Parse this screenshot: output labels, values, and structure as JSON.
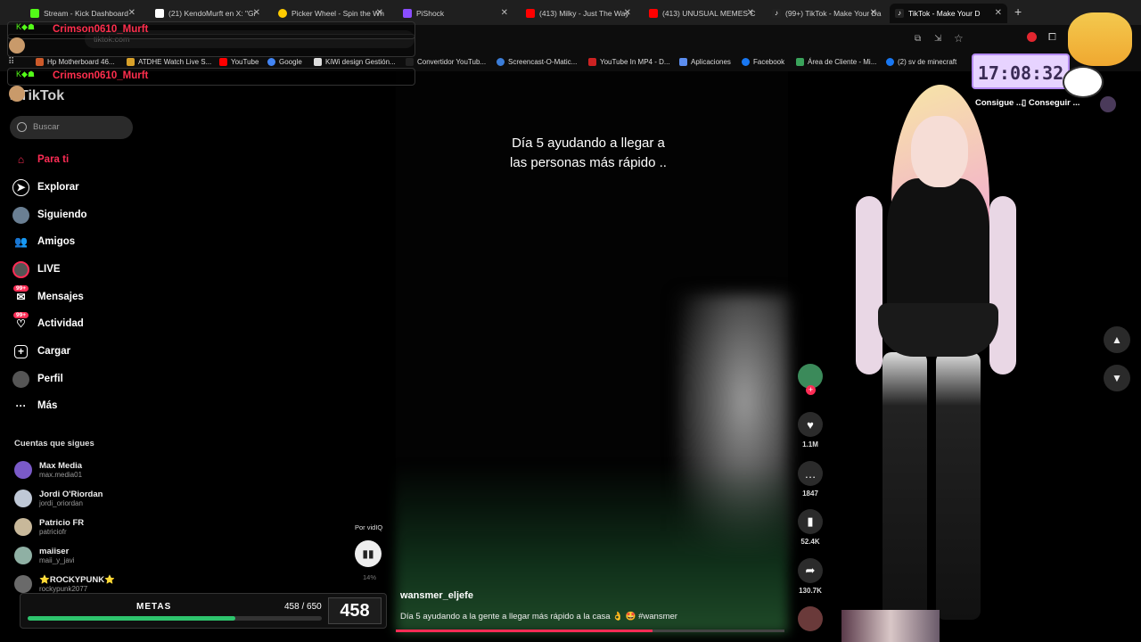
{
  "browser": {
    "tabs": [
      {
        "label": "Stream - Kick Dashboard",
        "color": "#53fc18"
      },
      {
        "label": "(21) KendoMurft en X: \"Gr",
        "color": "#ffffff"
      },
      {
        "label": "Picker Wheel - Spin the Wh",
        "color": "#ffcc00"
      },
      {
        "label": "PiShock",
        "color": "#8a4dff"
      },
      {
        "label": "(413) Milky - Just The Way",
        "color": "#ff0000"
      },
      {
        "label": "(413) UNUSUAL MEMES C",
        "color": "#ff0000"
      },
      {
        "label": "(99+) TikTok - Make Your Da",
        "color": "#ffffff"
      },
      {
        "label": "TikTok - Make Your D",
        "color": "#ffffff"
      }
    ],
    "url": "tiktok.com",
    "bookmarks": [
      "Hp Motherboard 46...",
      "ATDHE Watch Live S...",
      "YouTube",
      "Google",
      "KiWi design Gestión...",
      "Convertidor YouTub...",
      "Screencast-O-Matic...",
      "YouTube In MP4 - D...",
      "Aplicaciones",
      "Facebook",
      "Área de Cliente - Mi...",
      "(2) sv de minecraft"
    ]
  },
  "overlay": {
    "chat_user": "Crimson0610_Murft",
    "clock": "17:08:32",
    "metas": {
      "label": "METAS",
      "fraction": "458 / 650",
      "count": "458",
      "progress": 0.705
    }
  },
  "tiktok": {
    "logo": "TikTok",
    "search_placeholder": "Buscar",
    "top_buttons": [
      "Consigue ...",
      "Conseguir ..."
    ],
    "nav": [
      {
        "label": "Para ti",
        "icon": "home-icon",
        "active": true
      },
      {
        "label": "Explorar",
        "icon": "compass-icon"
      },
      {
        "label": "Siguiendo",
        "icon": "following-icon"
      },
      {
        "label": "Amigos",
        "icon": "friends-icon"
      },
      {
        "label": "LIVE",
        "icon": "live-icon"
      },
      {
        "label": "Mensajes",
        "icon": "messages-icon",
        "badge": "99+"
      },
      {
        "label": "Actividad",
        "icon": "activity-icon",
        "badge": "99+"
      },
      {
        "label": "Cargar",
        "icon": "upload-icon"
      },
      {
        "label": "Perfil",
        "icon": "profile-icon"
      },
      {
        "label": "Más",
        "icon": "more-icon"
      }
    ],
    "following_title": "Cuentas que sigues",
    "following": [
      {
        "name": "Max Media",
        "handle": "max.media01",
        "color": "#7a5ac8"
      },
      {
        "name": "Jordi O'Riordan",
        "handle": "jordi_oriordan",
        "color": "#bfc8d6"
      },
      {
        "name": "Patricio FR",
        "handle": "patriciofr",
        "color": "#c8b89a"
      },
      {
        "name": "maiiser",
        "handle": "maii_y_javi",
        "color": "#8fb0a4"
      },
      {
        "name": "⭐ROCKYPUNK⭐",
        "handle": "rockypunk2077",
        "color": "#6a6a6a"
      }
    ],
    "video": {
      "caption_line1": "Día 5 ayudando a llegar a",
      "caption_line2": "las personas más rápido ..",
      "author": "wansmer_eljefe",
      "description": "Día 5 ayudando a la gente a llegar más rápido a la casa 👌 🤩 #wansmer",
      "progress": 0.66
    },
    "actions": {
      "likes": "1.1M",
      "comments": "1847",
      "saves": "52.4K",
      "shares": "130.7K"
    },
    "vidiq": {
      "label": "Por vidIQ",
      "percent": "14%"
    }
  }
}
